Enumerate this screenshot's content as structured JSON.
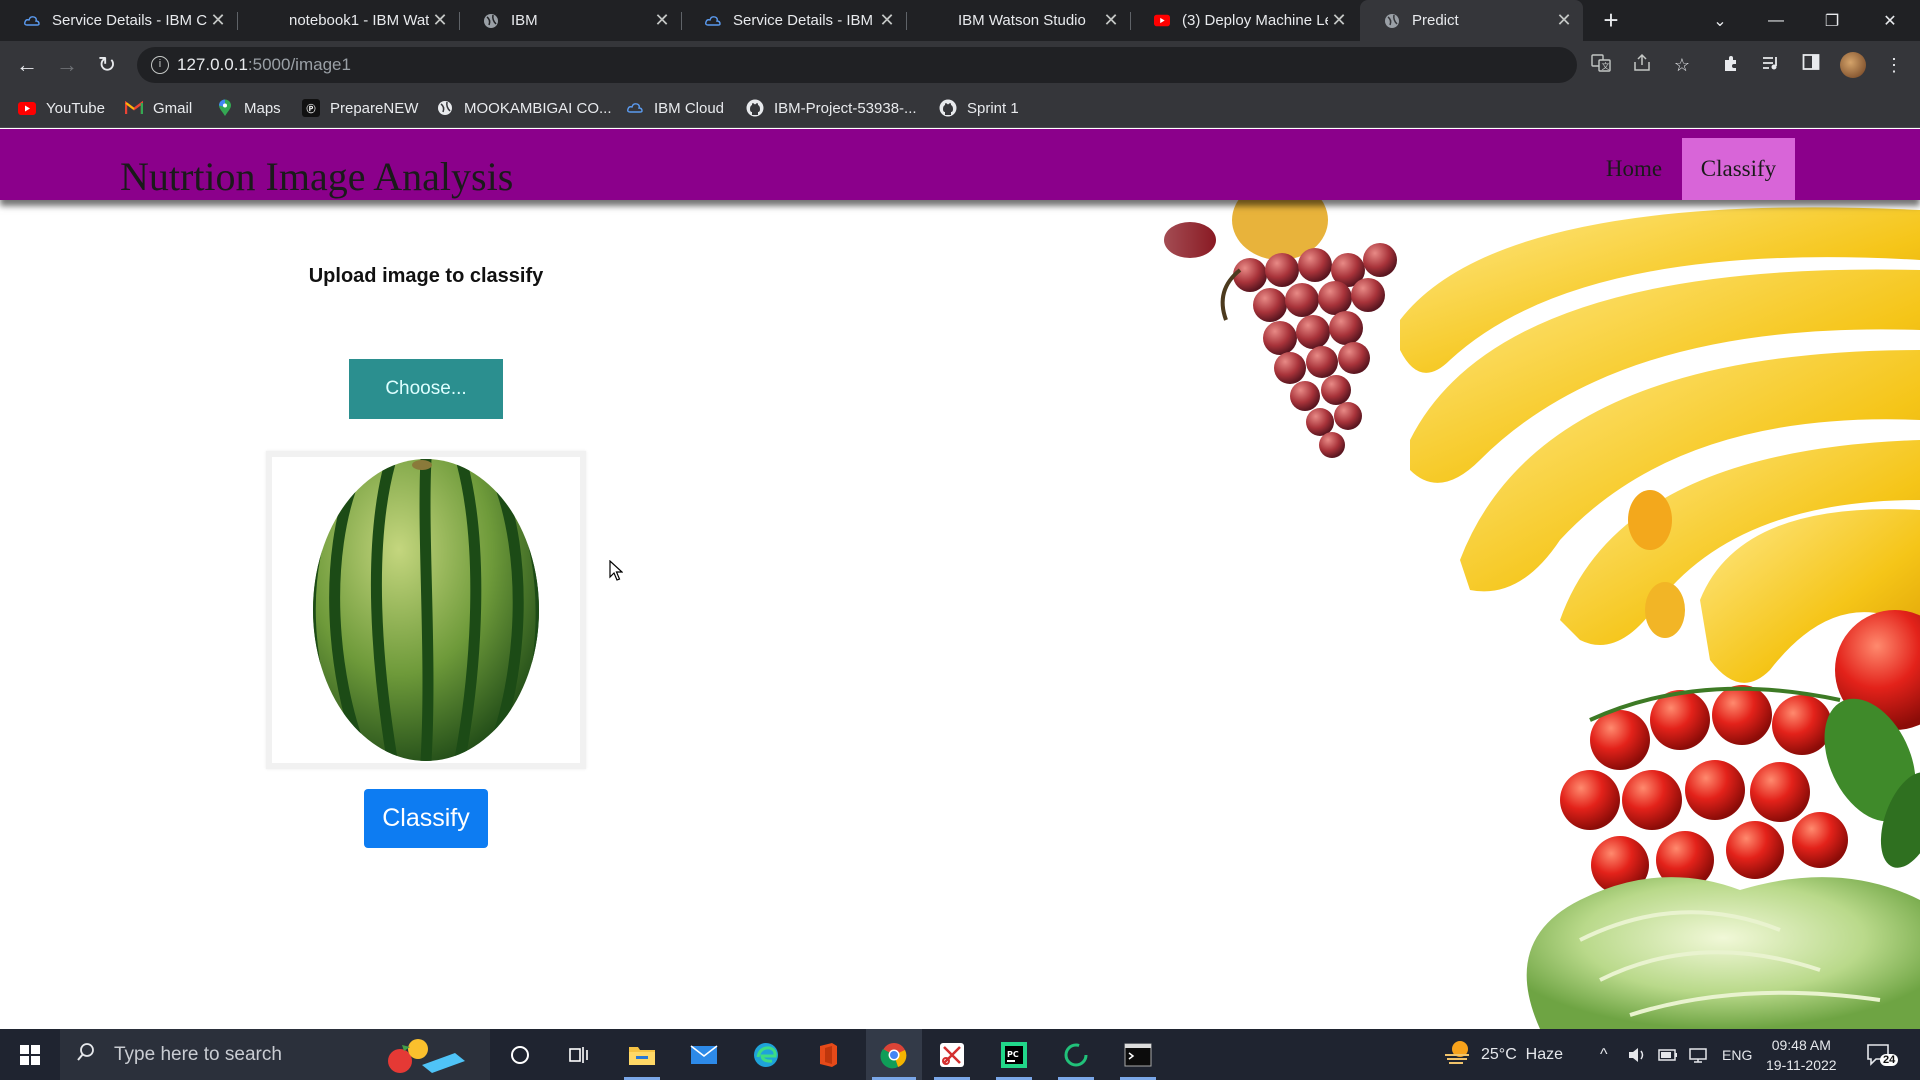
{
  "browser": {
    "tabs": [
      {
        "title": "Service Details - IBM C",
        "icon": "ibm-cloud-icon"
      },
      {
        "title": "notebook1 - IBM Wat",
        "icon": "none"
      },
      {
        "title": "IBM",
        "icon": "globe-icon"
      },
      {
        "title": "Service Details - IBM C",
        "icon": "ibm-cloud-icon"
      },
      {
        "title": "IBM Watson Studio",
        "icon": "none"
      },
      {
        "title": "(3) Deploy Machine Le",
        "icon": "youtube-icon"
      },
      {
        "title": "Predict",
        "icon": "globe-icon",
        "active": true
      }
    ],
    "new_tab_label": "+",
    "url_host": "127.0.0.1",
    "url_path": ":5000/image1",
    "bookmarks": [
      {
        "label": "YouTube",
        "icon": "youtube-icon"
      },
      {
        "label": "Gmail",
        "icon": "gmail-icon"
      },
      {
        "label": "Maps",
        "icon": "maps-icon"
      },
      {
        "label": "PrepareNEW",
        "icon": "preparenew-icon"
      },
      {
        "label": "MOOKAMBIGAI CO...",
        "icon": "globe-icon"
      },
      {
        "label": "IBM Cloud",
        "icon": "ibm-cloud-icon"
      },
      {
        "label": "IBM-Project-53938-...",
        "icon": "github-icon"
      },
      {
        "label": "Sprint 1",
        "icon": "github-icon"
      }
    ]
  },
  "page": {
    "brand": "Nutrtion Image Analysis",
    "nav": {
      "home": "Home",
      "classify": "Classify"
    },
    "upload_title": "Upload image to classify",
    "choose_label": "Choose...",
    "classify_label": "Classify",
    "preview_subject": "watermelon"
  },
  "taskbar": {
    "search_placeholder": "Type here to search",
    "weather": "25°C  Haze",
    "language": "ENG",
    "time": "09:48 AM",
    "date": "19-11-2022",
    "notification_count": "24"
  },
  "colors": {
    "navbar": "#8b008b",
    "active_nav": "#d865d8",
    "choose_button": "#2b8f8f",
    "classify_button": "#0d7cf2"
  }
}
